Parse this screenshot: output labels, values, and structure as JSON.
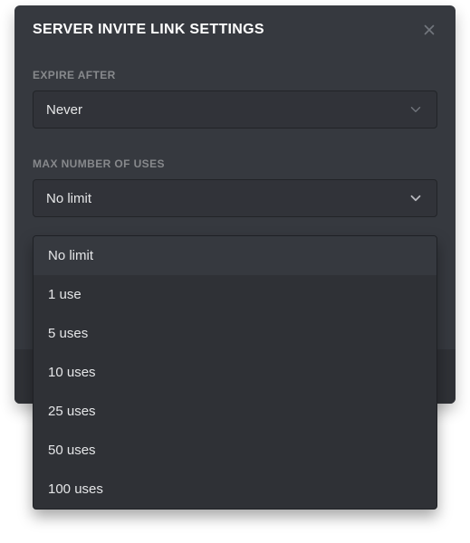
{
  "modal": {
    "title": "SERVER INVITE LINK SETTINGS"
  },
  "expire": {
    "label": "EXPIRE AFTER",
    "value": "Never"
  },
  "maxUses": {
    "label": "MAX NUMBER OF USES",
    "value": "No limit",
    "options": [
      "No limit",
      "1 use",
      "5 uses",
      "10 uses",
      "25 uses",
      "50 uses",
      "100 uses"
    ]
  }
}
